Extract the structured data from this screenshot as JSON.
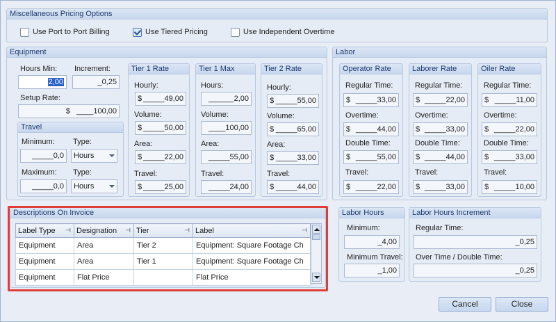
{
  "misc": {
    "title": "Miscellaneous Pricing Options",
    "options": [
      {
        "label": "Use Port to Port Billing",
        "checked": false
      },
      {
        "label": "Use Tiered Pricing",
        "checked": true
      },
      {
        "label": "Use Independent Overtime",
        "checked": false
      }
    ]
  },
  "equipment": {
    "title": "Equipment",
    "hours_min_label": "Hours Min:",
    "hours_min_value": "2,00",
    "increment_label": "Increment:",
    "increment_value": "_0,25",
    "setup_rate_label": "Setup Rate:",
    "setup_rate_value": "____100,00",
    "travel": {
      "title": "Travel",
      "minimum_label": "Minimum:",
      "minimum_value": "_____0,0",
      "type_label": "Type:",
      "type_value": "Hours",
      "maximum_label": "Maximum:",
      "maximum_value": "_____0,0",
      "type2_label": "Type:",
      "type2_value": "Hours"
    },
    "tier1_rate": {
      "title": "Tier 1 Rate",
      "hourly_label": "Hourly:",
      "hourly_value": "_____49,00",
      "volume_label": "Volume:",
      "volume_value": "_____50,00",
      "area_label": "Area:",
      "area_value": "_____22,00",
      "travel_label": "Travel:",
      "travel_value": "_____25,00"
    },
    "tier1_max": {
      "title": "Tier 1 Max",
      "hours_label": "Hours:",
      "hours_value": "______2,00",
      "volume_label": "Volume:",
      "volume_value": "____100,00",
      "area_label": "Area:",
      "area_value": "_____55,00",
      "travel_label": "Travel:",
      "travel_value": "_____24,00"
    },
    "tier2_rate": {
      "title": "Tier 2 Rate",
      "hourly_label": "Hourly:",
      "hourly_value": "_____55,00",
      "volume_label": "Volume:",
      "volume_value": "_____65,00",
      "area_label": "Area:",
      "area_value": "_____33,00",
      "travel_label": "Travel:",
      "travel_value": "_____44,00"
    }
  },
  "labor": {
    "title": "Labor",
    "operator": {
      "title": "Operator Rate",
      "regular_label": "Regular Time:",
      "regular_value": "_____33,00",
      "overtime_label": "Overtime:",
      "overtime_value": "_____44,00",
      "double_label": "Double Time:",
      "double_value": "_____55,00",
      "travel_label": "Travel:",
      "travel_value": "_____22,00"
    },
    "laborer": {
      "title": "Laborer Rate",
      "regular_label": "Regular Time:",
      "regular_value": "_____22,00",
      "overtime_label": "Overtime:",
      "overtime_value": "_____33,00",
      "double_label": "Double Time:",
      "double_value": "_____44,00",
      "travel_label": "Travel:",
      "travel_value": "_____33,00"
    },
    "oiler": {
      "title": "Oiler Rate",
      "regular_label": "Regular Time:",
      "regular_value": "_____11,00",
      "overtime_label": "Overtime:",
      "overtime_value": "_____22,00",
      "double_label": "Double Time:",
      "double_value": "_____33,00",
      "travel_label": "Travel:",
      "travel_value": "_____10,00"
    },
    "hours": {
      "title": "Labor Hours",
      "minimum_label": "Minimum:",
      "minimum_value": "_4,00",
      "min_travel_label": "Minimum Travel:",
      "min_travel_value": "_1,00"
    },
    "increment": {
      "title": "Labor Hours Increment",
      "regular_label": "Regular Time:",
      "regular_value": "_0,25",
      "ot_label": "Over Time / Double Time:",
      "ot_value": "_0,25"
    }
  },
  "descriptions": {
    "title": "Descriptions On Invoice",
    "columns": [
      "Label Type",
      "Designation",
      "Tier",
      "Label"
    ],
    "rows": [
      [
        "Equipment",
        "Area",
        "Tier 2",
        "Equipment: Square Footage Ch"
      ],
      [
        "Equipment",
        "Area",
        "Tier 1",
        "Equipment: Square Footage Ch"
      ],
      [
        "Equipment",
        "Flat Price",
        "",
        "Flat Price"
      ]
    ],
    "highlight_color": "#e03c3c"
  },
  "buttons": {
    "cancel": "Cancel",
    "close": "Close"
  }
}
